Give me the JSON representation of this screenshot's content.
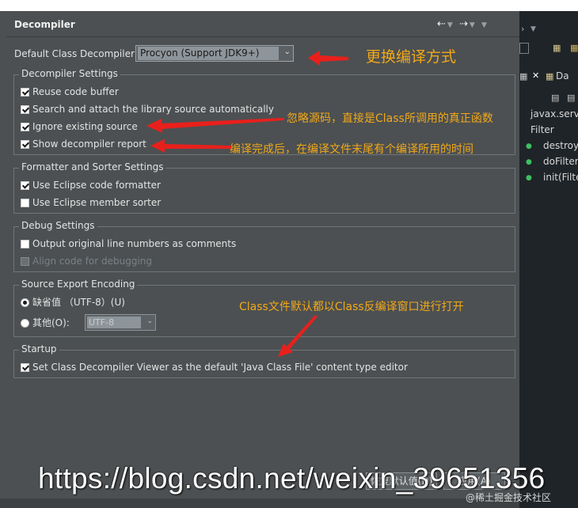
{
  "panel": {
    "title": "Decompiler",
    "default_label": "Default Class Decompiler",
    "default_value": "Procyon (Support JDK9+)"
  },
  "groups": {
    "decompiler_settings": {
      "title": "Decompiler Settings",
      "items": [
        {
          "label": "Reuse code buffer",
          "checked": true
        },
        {
          "label": "Search and attach the library source automatically",
          "checked": true
        },
        {
          "label": "Ignore existing source",
          "checked": true
        },
        {
          "label": "Show decompiler report",
          "checked": true
        }
      ]
    },
    "formatter": {
      "title": "Formatter and Sorter Settings",
      "items": [
        {
          "label": "Use Eclipse code formatter",
          "checked": true
        },
        {
          "label": "Use Eclipse member sorter",
          "checked": false
        }
      ]
    },
    "debug": {
      "title": "Debug Settings",
      "items": [
        {
          "label": "Output original line numbers as comments",
          "checked": false
        },
        {
          "label": "Align code for debugging",
          "checked": false,
          "disabled": true
        }
      ]
    },
    "encoding": {
      "title": "Source Export Encoding",
      "default_option": "缺省值 （UTF-8）(U)",
      "other_option": "其他(O):",
      "other_value": "UTF-8"
    },
    "startup": {
      "title": "Startup",
      "items": [
        {
          "label": "Set Class Decompiler Viewer as the default 'Java Class File' content type editor",
          "checked": true
        }
      ]
    }
  },
  "buttons": {
    "restore_defaults": "恢复默认值(D)",
    "apply": "应用(A)"
  },
  "annotations": {
    "change_method": "更换编译方式",
    "ignore_source": "忽略源码，直接是Class所调用的真正函数",
    "report": "编译完成后，在编译文件末尾有个编译所用的时间",
    "default_open": "Class文件默认都以Class反编译窗口进行打开"
  },
  "overlay": {
    "url": "https://blog.csdn.net/weixin_39651356",
    "watermark": "@稀土掘金技术社区"
  },
  "right_panel": {
    "tab_label": "Da",
    "tree_root": "javax.servl",
    "tree_sub": "Filter",
    "methods": [
      "destroy",
      "doFilter",
      "init(Filte"
    ]
  },
  "colors": {
    "panel_bg": "#4c5052",
    "annotation": "#f2a818",
    "arrow": "#e8201c",
    "ide_dark": "#1f2428"
  }
}
